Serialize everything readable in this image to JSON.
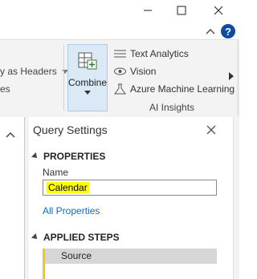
{
  "window": {
    "help_label": "?"
  },
  "ribbon": {
    "headers_label": "y as Headers",
    "rows_label": "es",
    "combine_label": "Combine",
    "ai_items": [
      {
        "label": "Text Analytics",
        "icon": "text-analytics-icon"
      },
      {
        "label": "Vision",
        "icon": "eye-icon"
      },
      {
        "label": "Azure Machine Learning",
        "icon": "flask-icon"
      }
    ],
    "ai_group_label": "AI Insights"
  },
  "query_settings": {
    "title": "Query Settings",
    "properties_header": "PROPERTIES",
    "name_label": "Name",
    "name_value": "Calendar",
    "all_properties_link": "All Properties",
    "applied_steps_header": "APPLIED STEPS",
    "steps": [
      "Source"
    ]
  },
  "colors": {
    "ribbon_bg": "#f3f3f3",
    "combine_highlight": "#dbe9f6",
    "link": "#0f6cbd",
    "step_selected": "#d6d6d6",
    "step_marker": "#f2c811",
    "name_highlight": "#ffff00",
    "help_badge": "#0f4c9f"
  }
}
